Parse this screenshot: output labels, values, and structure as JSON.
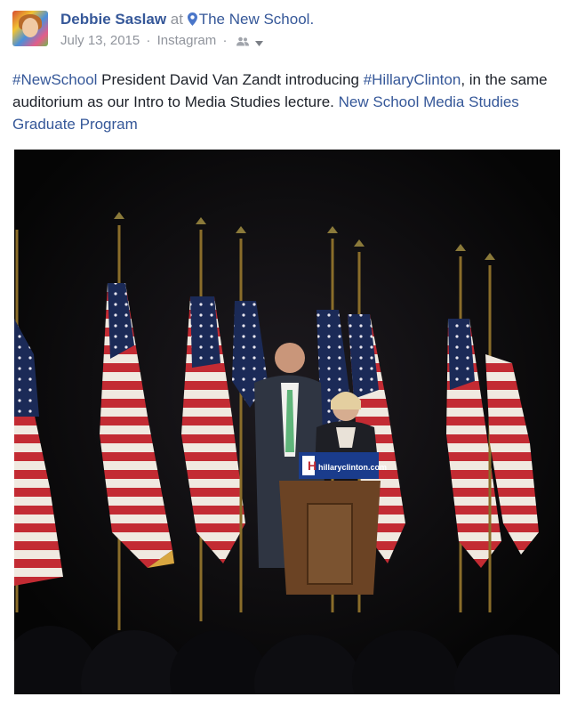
{
  "post": {
    "author": "Debbie Saslaw",
    "at_text": "at",
    "location": "The New School.",
    "date": "July 13, 2015",
    "separator": "·",
    "source": "Instagram",
    "icons": {
      "location": "map-pin-icon",
      "audience": "friends-icon",
      "menu": "caret-down-icon"
    },
    "body": {
      "hashtag_1": "#NewSchool",
      "text_1": " President David Van Zandt introducing ",
      "hashtag_2": "#HillaryClinton",
      "text_2": ", in the same auditorium as our Intro to Media Studies lecture. ",
      "page_link": "New School Media Studies Graduate Program"
    },
    "photo": {
      "podium_sign": "hillaryclinton.com"
    }
  },
  "colors": {
    "link": "#365899",
    "meta": "#90949c",
    "text": "#1d2129"
  }
}
